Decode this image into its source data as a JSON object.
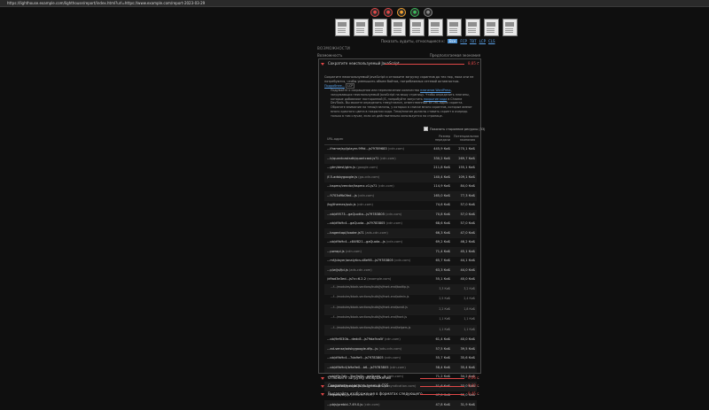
{
  "page": {
    "url": "https://lighthouse.example.com/lighthouse/report/index.html?url=https://www.example.com/report-2023-03-29",
    "tool_icons": [
      {
        "name": "performance-icon",
        "color": "#e04747",
        "glyph": "●"
      },
      {
        "name": "accessibility-icon",
        "color": "#e04747",
        "glyph": "●"
      },
      {
        "name": "best-practices-icon",
        "color": "#f0a030",
        "glyph": "●"
      },
      {
        "name": "seo-icon",
        "color": "#3bb85a",
        "glyph": "●"
      },
      {
        "name": "pwa-icon",
        "color": "#8a8a8a",
        "glyph": "●"
      }
    ],
    "thumbnail_count": 10
  },
  "formats": {
    "label": "Показать аудиты, относящиеся к:",
    "items": [
      {
        "label": "Все",
        "active": true
      },
      {
        "label": "FCP",
        "active": false
      },
      {
        "label": "TBT",
        "active": false
      },
      {
        "label": "LCP",
        "active": false
      },
      {
        "label": "CLS",
        "active": false
      }
    ]
  },
  "diagnostics": {
    "heading": "ВОЗМОЖНОСТИ",
    "opportunity_label": "Возможность",
    "savings_label": "Предполагаемая экономия"
  },
  "open_audit": {
    "title": "Сократите неиспользуемый JavaScript",
    "value": "8,85 с",
    "description_1": "Сократите неиспользуемый JavaScript и отложите загрузку скриптов до тех пор, пока они не потребуются, чтобы уменьшить объем байтов, потребляемых сетевой активностью.",
    "description_link": "Подробнее...",
    "description_tag": "LCP",
    "tip_1": "Подумайте о сокращении или переключении количества",
    "tip_link_1": "плагинов WordPress",
    "tip_2": ", загружающих неиспользуемый JavaScript на вашу страницу. Чтобы определить плагины, которые добавляют посторонний JS, попробуйте запустить",
    "tip_link_2": "покрытие кода",
    "tip_3": "в Chrome DevTools. Вы можете определить тему/плагин, ответственный за URL-адрес скрипта. Обратите внимание на темы/плагины, у которых в списке много скриптов, которые имеют много красного цвета в покрытии кода. Тема/плагин должны ставить скрипт в очередь только в том случае, если он действительно используется на странице.",
    "third_party_label": "Показать сторонние ресурсы (33)"
  },
  "table": {
    "headers": {
      "url": "URL-адрес",
      "size": "Размер передачи",
      "savings": "Потенциальная экономия"
    },
    "rows": [
      {
        "url": "...iframe/api/player-9f9d...js?9789683",
        "host": "(cdn.com)",
        "size": "445,9 КиБ",
        "savings": "270,1 КиБ",
        "sub": false
      },
      {
        "url": "...b/quantcastsdk/quantcast.js?1",
        "host": "(cdn.com)",
        "size": "330,2 КиБ",
        "savings": "269,7 КиБ",
        "sub": false
      },
      {
        "url": "...gtm/dest/gtm.js",
        "host": "(google.com)",
        "size": "211,8 КиБ",
        "savings": "155,1 КиБ",
        "sub": false
      },
      {
        "url": "/f-5-adsbygoogle.js",
        "host": "(ga-cdn.com)",
        "size": "140,4 КиБ",
        "savings": "109,1 КиБ",
        "sub": false
      },
      {
        "url": "...bspmx/vendor/bspmx.v1.js?1",
        "host": "(cdn.com)",
        "size": "114,9 КиБ",
        "savings": "84,0 КиБ",
        "sub": false
      },
      {
        "url": "...9703d9b0fed...js",
        "host": "(cdn.com)",
        "size": "165,0 КиБ",
        "savings": "77,3 КиБ",
        "sub": false
      },
      {
        "url": "/bg/themes/pub.js",
        "host": "(cdn.com)",
        "size": "74,6 КиБ",
        "savings": "57,0 КиБ",
        "sub": false
      },
      {
        "url": "...ob/d9573...gaQuotta...js?9783805",
        "host": "(cdn.com)",
        "size": "70,8 КиБ",
        "savings": "57,0 КиБ",
        "sub": false
      },
      {
        "url": "...ob/d9b9c4...gaQuota...js?9783805",
        "host": "(cdn.com)",
        "size": "68,6 КиБ",
        "savings": "57,0 КиБ",
        "sub": false
      },
      {
        "url": "...kagentapi/loader.js?1",
        "host": "(ads-cdn.com)",
        "size": "66,3 КиБ",
        "savings": "47,0 КиБ",
        "sub": false
      },
      {
        "url": "...ob/d9b9c4...c84f821...gaQuota...js",
        "host": "(cdn.com)",
        "size": "69,2 КиБ",
        "savings": "46,2 КиБ",
        "sub": false
      },
      {
        "url": "...pwrapi.js",
        "host": "(cdn.com)",
        "size": "71,4 КиБ",
        "savings": "45,1 КиБ",
        "sub": false
      },
      {
        "url": "...mf/player/analytics-d8e98...js?9783805",
        "host": "(cdn.com)",
        "size": "65,7 КиБ",
        "savings": "44,1 КиБ",
        "sub": false
      },
      {
        "url": "...p/w/js/fpi.js",
        "host": "(ads-cdn.com)",
        "size": "63,3 КиБ",
        "savings": "44,0 КиБ",
        "sub": false
      },
      {
        "url": "/d9ad3e3ed...js?v=6.2.2",
        "host": "(example.com)",
        "size": "55,1 КиБ",
        "savings": "40,0 КиБ",
        "sub": false
      },
      {
        "url": "...f.../modules/block-sections/build/js/front-end/tooltip.js",
        "host": "",
        "size": "3,3 КиБ",
        "savings": "3,2 КиБ",
        "sub": true
      },
      {
        "url": "...f.../modules/block-sections/build/js/front-end/admin.js",
        "host": "",
        "size": "2,5 КиБ",
        "savings": "2,4 КиБ",
        "sub": true
      },
      {
        "url": "...f.../modules/block-sections/build/js/front-end/scroll.js",
        "host": "",
        "size": "2,2 КиБ",
        "savings": "1,8 КиБ",
        "sub": true
      },
      {
        "url": "...f.../modules/block-sections/build/js/front-end/front.js",
        "host": "",
        "size": "1,1 КиБ",
        "savings": "1,1 КиБ",
        "sub": true
      },
      {
        "url": "...f.../modules/block-sections/build/js/front-end/helpers.js",
        "host": "",
        "size": "1,1 КиБ",
        "savings": "1,1 КиБ",
        "sub": true
      },
      {
        "url": "...ob/9ef030b...dedc8...js?9da9ca5f",
        "host": "(cdn.com)",
        "size": "61,4 КиБ",
        "savings": "40,0 КиБ",
        "sub": false
      },
      {
        "url": "...ad-sense/adsbygoogle-dfp...js",
        "host": "(ads-cdn.com)",
        "size": "57,5 КиБ",
        "savings": "39,5 КиБ",
        "sub": false
      },
      {
        "url": "...ob/d9b9c4...7da9e9...js?9783805",
        "host": "(cdn.com)",
        "size": "55,7 КиБ",
        "savings": "35,6 КиБ",
        "sub": false
      },
      {
        "url": "...ob/d9b9c4/b9a9e0...b6...js?9783805",
        "host": "(cdn.com)",
        "size": "58,4 КиБ",
        "savings": "35,4 КиБ",
        "sub": false
      },
      {
        "url": "...ob/d9c7db...3bc9a0b...gaQuota...js",
        "host": "(cdn.com)",
        "size": "71,2 КиБ",
        "savings": "34,2 КиБ",
        "sub": false
      },
      {
        "url": "...ads/adsbygoogle.js",
        "host": "(pagead2.googlesyndication.com)",
        "size": "51,6 КиБ",
        "savings": "33,0 КиБ",
        "sub": false
      },
      {
        "url": "...bfyads/bfy.js",
        "host": "(ads-cdn.com)",
        "size": "47,0 КиБ",
        "savings": "33,0 КиБ",
        "sub": false
      },
      {
        "url": "...pbjs/prebid-7.49.0.js",
        "host": "(cdn.com)",
        "size": "47,8 КиБ",
        "savings": "31,9 КиБ",
        "sub": false
      }
    ]
  },
  "collapsed_audits": [
    {
      "title": "Отложите загрузку изображений",
      "value": "0,06 с"
    },
    {
      "title": "Сократите неиспользуемый CSS",
      "value": "0,63 с"
    },
    {
      "title": "Выдавайте изображения в форматах следующего",
      "value": "0,45 с"
    }
  ]
}
